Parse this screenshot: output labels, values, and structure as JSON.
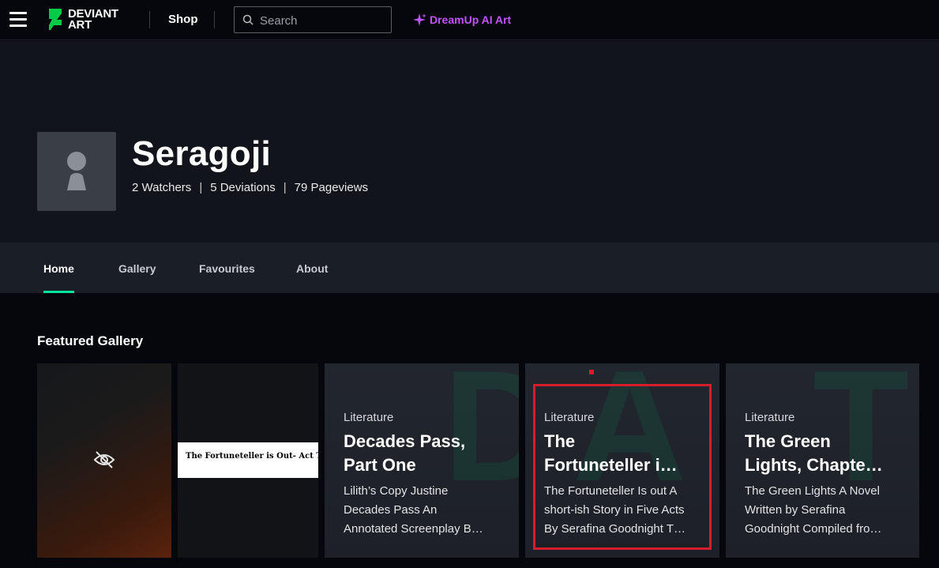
{
  "topbar": {
    "logo_line1": "DEVIANT",
    "logo_line2": "ART",
    "shop_label": "Shop",
    "search_placeholder": "Search",
    "dreamup_label": "DreamUp AI Art"
  },
  "profile": {
    "username": "Seragoji",
    "watchers": "2 Watchers",
    "deviations": "5 Deviations",
    "pageviews": "79 Pageviews",
    "separator": "|"
  },
  "tabs": [
    {
      "label": "Home",
      "active": true
    },
    {
      "label": "Gallery",
      "active": false
    },
    {
      "label": "Favourites",
      "active": false
    },
    {
      "label": "About",
      "active": false
    }
  ],
  "featured": {
    "title": "Featured Gallery",
    "cards": [
      {
        "type": "hidden-image",
        "icon": "eye-slash-icon"
      },
      {
        "type": "image",
        "thumb_text": "The Fortuneteller is Out- Act Two"
      },
      {
        "type": "literature",
        "category": "Literature",
        "title_lines": [
          "Decades Pass,",
          "Part One"
        ],
        "desc_lines": [
          "Lilith’s Copy Justine",
          "Decades Pass An",
          "Annotated Screenplay B…"
        ]
      },
      {
        "type": "literature",
        "category": "Literature",
        "title_lines": [
          "The",
          "Fortuneteller i…"
        ],
        "desc_lines": [
          "The Fortuneteller Is out A",
          "short-ish Story in Five Acts",
          "By Serafina Goodnight T…"
        ]
      },
      {
        "type": "literature",
        "category": "Literature",
        "title_lines": [
          "The Green",
          "Lights, Chapte…"
        ],
        "desc_lines": [
          "The Green Lights A Novel",
          "Written by Serafina",
          "Goodnight Compiled fro…"
        ]
      }
    ]
  },
  "colors": {
    "accent": "#00e59b",
    "dreamup": "#c452ff",
    "highlight": "#d61d2b"
  }
}
